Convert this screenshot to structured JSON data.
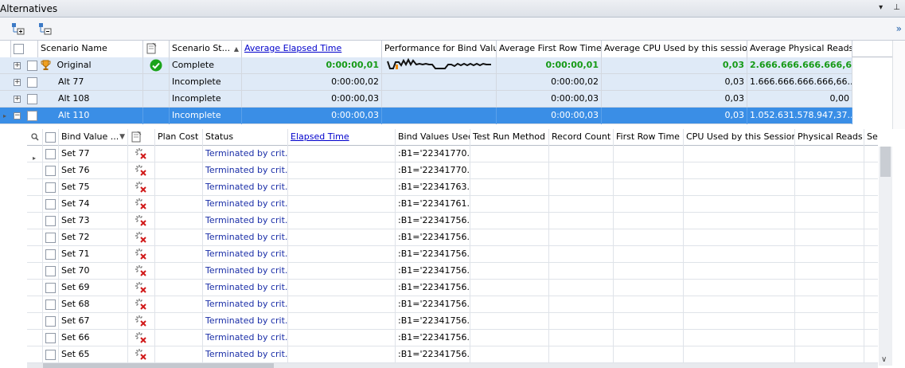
{
  "window": {
    "title": "Alternatives",
    "pin_glyph": "▾",
    "dock_glyph": "⊥"
  },
  "master": {
    "columns": [
      "Scenario Name",
      "Scenario St...",
      "Average Elapsed Time",
      "Performance for Bind Valu...",
      "Average First Row Time",
      "Average CPU Used by this session",
      "Average Physical Reads"
    ],
    "rows": [
      {
        "name": "Original",
        "status": "Complete",
        "elapsed": "0:00:00,01",
        "first_row": "0:00:00,01",
        "cpu": "0,03",
        "reads": "2.666.666.666.666,6..."
      },
      {
        "name": "Alt 77",
        "status": "Incomplete",
        "elapsed": "0:00:00,02",
        "first_row": "0:00:00,02",
        "cpu": "0,03",
        "reads": "1.666.666.666.666,66..."
      },
      {
        "name": "Alt 108",
        "status": "Incomplete",
        "elapsed": "0:00:00,03",
        "first_row": "0:00:00,03",
        "cpu": "0,03",
        "reads": "0,00"
      },
      {
        "name": "Alt 110",
        "status": "Incomplete",
        "elapsed": "0:00:00,03",
        "first_row": "0:00:00,03",
        "cpu": "0,03",
        "reads": "1.052.631.578.947,37..."
      }
    ]
  },
  "detail": {
    "columns": [
      "Bind Value ...",
      "Plan Cost",
      "Status",
      "Elapsed Time",
      "Bind Values Used",
      "Test Run Method",
      "Record Count",
      "First Row Time",
      "CPU Used by this Session",
      "Physical Reads",
      "Se"
    ],
    "rows": [
      {
        "name": "Set 77",
        "status": "Terminated by crit...",
        "bind": ":B1='22341770..."
      },
      {
        "name": "Set 76",
        "status": "Terminated by crit...",
        "bind": ":B1='22341770..."
      },
      {
        "name": "Set 75",
        "status": "Terminated by crit...",
        "bind": ":B1='22341763..."
      },
      {
        "name": "Set 74",
        "status": "Terminated by crit...",
        "bind": ":B1='22341761..."
      },
      {
        "name": "Set 73",
        "status": "Terminated by crit...",
        "bind": ":B1='22341756..."
      },
      {
        "name": "Set 72",
        "status": "Terminated by crit...",
        "bind": ":B1='22341756..."
      },
      {
        "name": "Set 71",
        "status": "Terminated by crit...",
        "bind": ":B1='22341756..."
      },
      {
        "name": "Set 70",
        "status": "Terminated by crit...",
        "bind": ":B1='22341756..."
      },
      {
        "name": "Set 69",
        "status": "Terminated by crit...",
        "bind": ":B1='22341756..."
      },
      {
        "name": "Set 68",
        "status": "Terminated by crit...",
        "bind": ":B1='22341756..."
      },
      {
        "name": "Set 67",
        "status": "Terminated by crit...",
        "bind": ":B1='22341756..."
      },
      {
        "name": "Set 66",
        "status": "Terminated by crit...",
        "bind": ":B1='22341756..."
      },
      {
        "name": "Set 65",
        "status": "Terminated by crit...",
        "bind": ":B1='22341756..."
      }
    ]
  },
  "colors": {
    "selected_row": "#3a8ee6",
    "highlight_row": "#dfeaf7",
    "best_value": "#169a16",
    "status_text": "#1b2fa8"
  }
}
